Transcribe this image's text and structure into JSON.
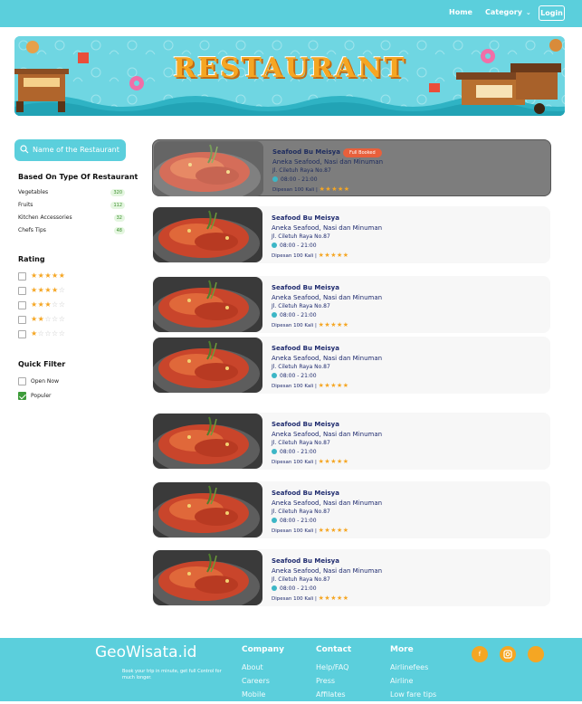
{
  "nav": {
    "home": "Home",
    "category": "Category",
    "login": "Login"
  },
  "banner": {
    "title": "RESTAURANT"
  },
  "sidebar": {
    "search_placeholder": "Name of the Restaurant",
    "type_heading": "Based On Type Of Restaurant",
    "types": [
      {
        "label": "Vegetables",
        "count": "320"
      },
      {
        "label": "Fruits",
        "count": "112"
      },
      {
        "label": "Kitchen Accessories",
        "count": "32"
      },
      {
        "label": "Chefs Tips",
        "count": "48"
      }
    ],
    "rating_heading": "Rating",
    "ratings": [
      5,
      4,
      3,
      2,
      1
    ],
    "quick_heading": "Quick Filter",
    "quick": [
      {
        "label": "Open Now",
        "checked": false
      },
      {
        "label": "Populer",
        "checked": true
      }
    ]
  },
  "cards": [
    {
      "name": "Seafood Bu Meisya",
      "desc": "Aneka Seafood, Nasi dan Minuman",
      "addr": "Jl. Ciletuh Raya No.87",
      "hours": "08:00 - 21:00",
      "order": "Dipesan 100 Kali |",
      "badge": "Full Booked",
      "selected": true
    },
    {
      "name": "Seafood Bu Meisya",
      "desc": "Aneka Seafood, Nasi dan Minuman",
      "addr": "Jl. Ciletuh Raya No.87",
      "hours": "08:00 - 21:00",
      "order": "Dipesan 100 Kali |"
    },
    {
      "name": "Seafood Bu Meisya",
      "desc": "Aneka Seafood, Nasi dan Minuman",
      "addr": "Jl. Ciletuh Raya No.87",
      "hours": "08:00 - 21:00",
      "order": "Dipesan 100 Kali |"
    },
    {
      "name": "Seafood Bu Meisya",
      "desc": "Aneka Seafood, Nasi dan Minuman",
      "addr": "Jl. Ciletuh Raya No.87",
      "hours": "08:00 - 21:00",
      "order": "Dipesan 100 Kali |"
    },
    {
      "name": "Seafood Bu Meisya",
      "desc": "Aneka Seafood, Nasi dan Minuman",
      "addr": "Jl. Ciletuh Raya No.87",
      "hours": "08:00 - 21:00",
      "order": "Dipesan 100 Kali |"
    },
    {
      "name": "Seafood Bu Meisya",
      "desc": "Aneka Seafood, Nasi dan Minuman",
      "addr": "Jl. Ciletuh Raya No.87",
      "hours": "08:00 - 21:00",
      "order": "Dipesan 100 Kali |"
    },
    {
      "name": "Seafood Bu Meisya",
      "desc": "Aneka Seafood, Nasi dan Minuman",
      "addr": "Jl. Ciletuh Raya No.87",
      "hours": "08:00 - 21:00",
      "order": "Dipesan 100 Kali |"
    }
  ],
  "footer": {
    "logo": "GeoWisata.id",
    "tagline": "Book your trip in minute, get full Control for much longer.",
    "company": {
      "heading": "Company",
      "links": [
        "About",
        "Careers",
        "Mobile"
      ]
    },
    "contact": {
      "heading": "Contact",
      "links": [
        "Help/FAQ",
        "Press",
        "Affilates"
      ]
    },
    "more": {
      "heading": "More",
      "links": [
        "Airlinefees",
        "Airline",
        "Low fare tips"
      ]
    },
    "social": [
      "f",
      "",
      ""
    ]
  },
  "colors": {
    "primary": "#5bcfdc",
    "accent": "#f5a623",
    "navy": "#1e2a6e",
    "badge": "#e8603c"
  }
}
